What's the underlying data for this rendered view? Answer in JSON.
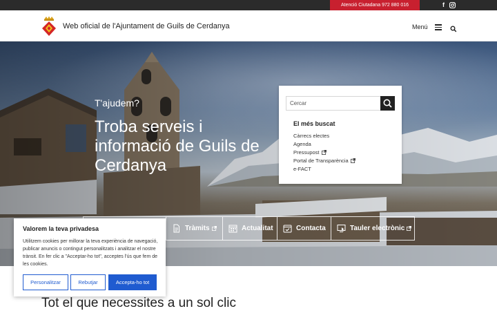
{
  "topbar": {
    "attention_label": "Atenció Ciutadana 972 880 016",
    "social": [
      {
        "icon": "facebook-icon",
        "glyph": "f"
      },
      {
        "icon": "instagram-icon",
        "glyph": ""
      }
    ],
    "accent_color": "#c8202f"
  },
  "header": {
    "site_title": "Web oficial de l'Ajuntament de Guils de Cerdanya",
    "menu_label": "Menú"
  },
  "hero": {
    "eyebrow": "T'ajudem?",
    "title": "Troba serveis i informació de Guils de Cerdanya"
  },
  "search_panel": {
    "placeholder": "Cercar",
    "most_searched_title": "El més buscat",
    "links": [
      {
        "label": "Càrrecs electes",
        "external": false
      },
      {
        "label": "Agenda",
        "external": false
      },
      {
        "label": "Pressupost",
        "external": true
      },
      {
        "label": "Portal de Transparència",
        "external": true
      },
      {
        "label": "e-FACT",
        "external": false
      }
    ]
  },
  "quick_links": [
    {
      "label": "",
      "icon": "hidden-item-icon",
      "external": false
    },
    {
      "label": "Tràmits",
      "icon": "document-icon",
      "external": true
    },
    {
      "label": "Actualitat",
      "icon": "calendar-grid-icon",
      "external": false
    },
    {
      "label": "Contacta",
      "icon": "calendar-check-icon",
      "external": false
    },
    {
      "label": "Tauler electrònic",
      "icon": "screen-cursor-icon",
      "external": true
    }
  ],
  "section": {
    "title": "Tot el que necessites a un sol clic"
  },
  "cookie_banner": {
    "title": "Valorem la teva privadesa",
    "body": "Utilitzem cookies per millorar la teva experiència de navegació, publicar anuncis o contingut personalitzats i analitzar el nostre trànsit. En fer clic a \"Acceptar-ho tot\", acceptes l'ús que fem de les cookies.",
    "customize_label": "Personalitzar",
    "reject_label": "Rebutjar",
    "accept_label": "Accepta-ho tot",
    "button_color": "#1f5bd0"
  }
}
